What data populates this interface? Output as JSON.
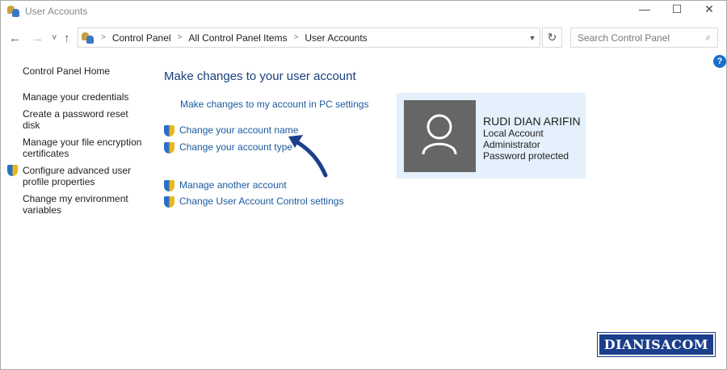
{
  "window": {
    "title": "User Accounts",
    "minimize": "—",
    "maximize": "☐",
    "close": "✕"
  },
  "nav": {
    "back": "←",
    "forward": "→",
    "recent": "˅",
    "up": "↑"
  },
  "breadcrumb": [
    "Control Panel",
    "All Control Panel Items",
    "User Accounts"
  ],
  "search": {
    "placeholder": "Search Control Panel",
    "icon": "⌕"
  },
  "help": "?",
  "sidebar": {
    "home": "Control Panel Home",
    "items": [
      "Manage your credentials",
      "Create a password reset disk",
      "Manage your file encryption certificates",
      "Configure advanced user profile properties",
      "Change my environment variables"
    ]
  },
  "main": {
    "heading": "Make changes to your user account",
    "pc_settings": "Make changes to my account in PC settings",
    "links": [
      "Change your account name",
      "Change your account type",
      "Manage another account",
      "Change User Account Control settings"
    ]
  },
  "account": {
    "name": "RUDI DIAN ARIFIN",
    "type": "Local Account",
    "role": "Administrator",
    "password": "Password protected"
  },
  "watermark": "DIANISACOM"
}
